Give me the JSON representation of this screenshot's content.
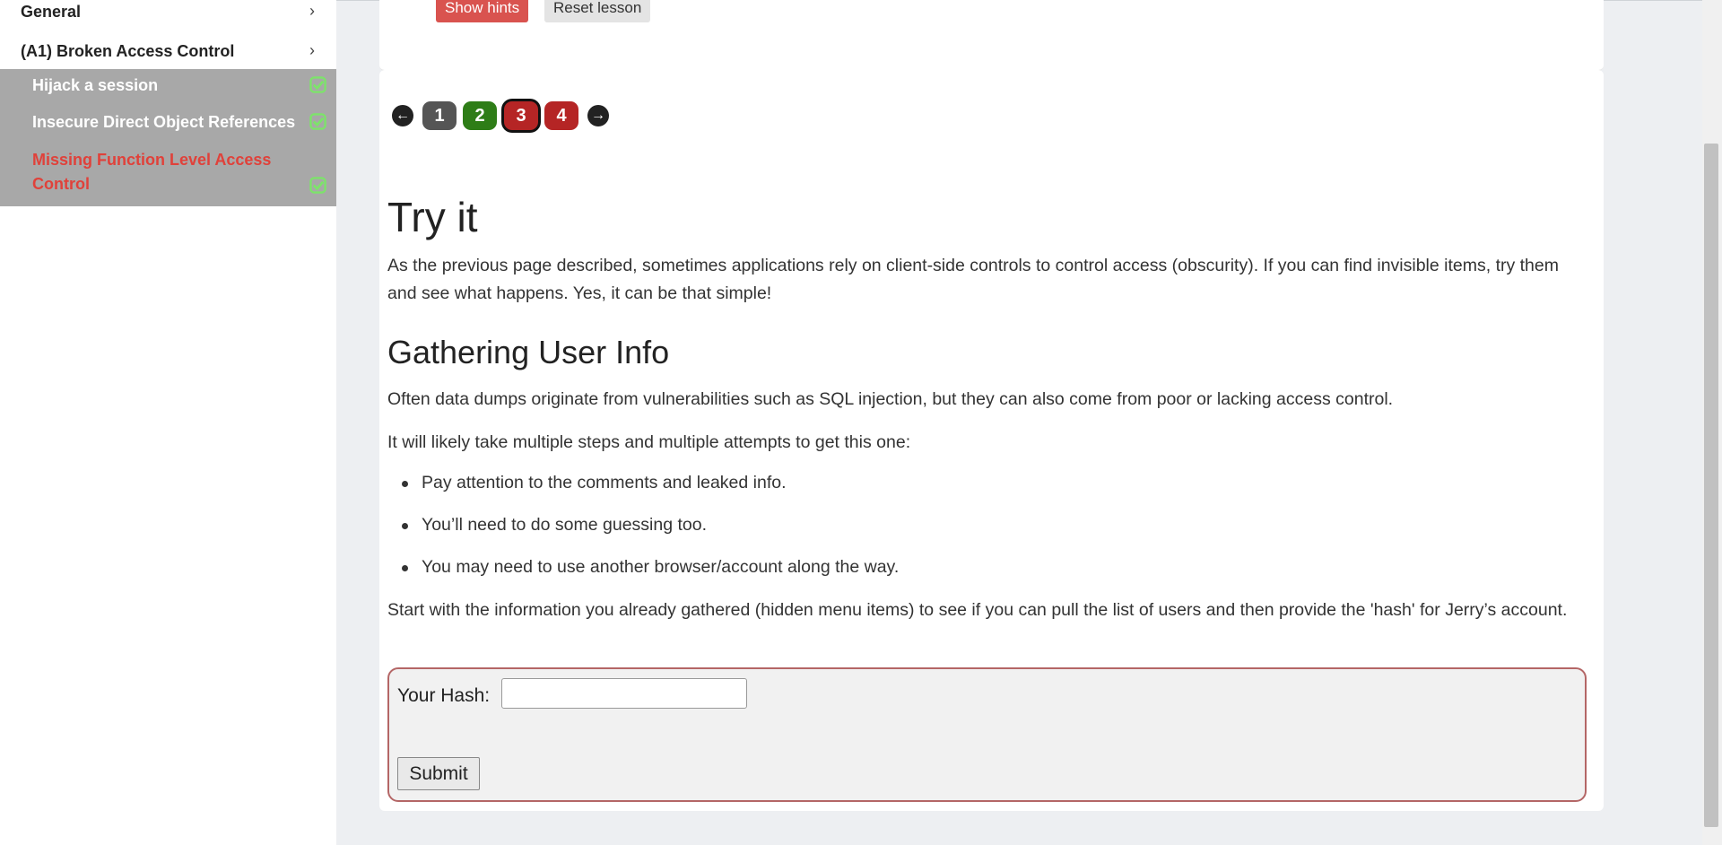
{
  "sidebar": {
    "categories": [
      {
        "label": "General"
      },
      {
        "label": "(A1) Broken Access Control"
      }
    ],
    "items": [
      {
        "label": "Hijack a session"
      },
      {
        "label": "Insecure Direct Object References"
      },
      {
        "label_line1": "Missing Function Level Access",
        "label_line2": "Control"
      }
    ]
  },
  "toolbar": {
    "show_hints": "Show hints",
    "reset_lesson": "Reset lesson"
  },
  "pager": {
    "pages": [
      "1",
      "2",
      "3",
      "4"
    ],
    "current": "3"
  },
  "content": {
    "title": "Try it",
    "intro": "As the previous page described, sometimes applications rely on client-side controls to control access (obscurity). If you can find invisible items, try them and see what happens. Yes, it can be that simple!",
    "heading": "Gathering User Info",
    "p1": "Often data dumps originate from vulnerabilities such as SQL injection, but they can also come from poor or lacking access control.",
    "p2": "It will likely take multiple steps and multiple attempts to get this one:",
    "bullets": [
      "Pay attention to the comments and leaked info.",
      "You’ll need to do some guessing too.",
      "You may need to use another browser/account along the way."
    ],
    "p3": "Start with the information you already gathered (hidden menu items) to see if you can pull the list of users and then provide the 'hash' for Jerry’s account."
  },
  "form": {
    "hash_label": "Your Hash:",
    "hash_value": "",
    "submit_label": "Submit"
  },
  "colors": {
    "active_lesson": "#e0413a",
    "check": "#7de36b",
    "danger": "#d9534f",
    "success_page": "#2e7d17"
  },
  "icons": [
    "chevron-right-icon",
    "check-square-icon",
    "arrow-left-icon",
    "arrow-right-icon"
  ]
}
